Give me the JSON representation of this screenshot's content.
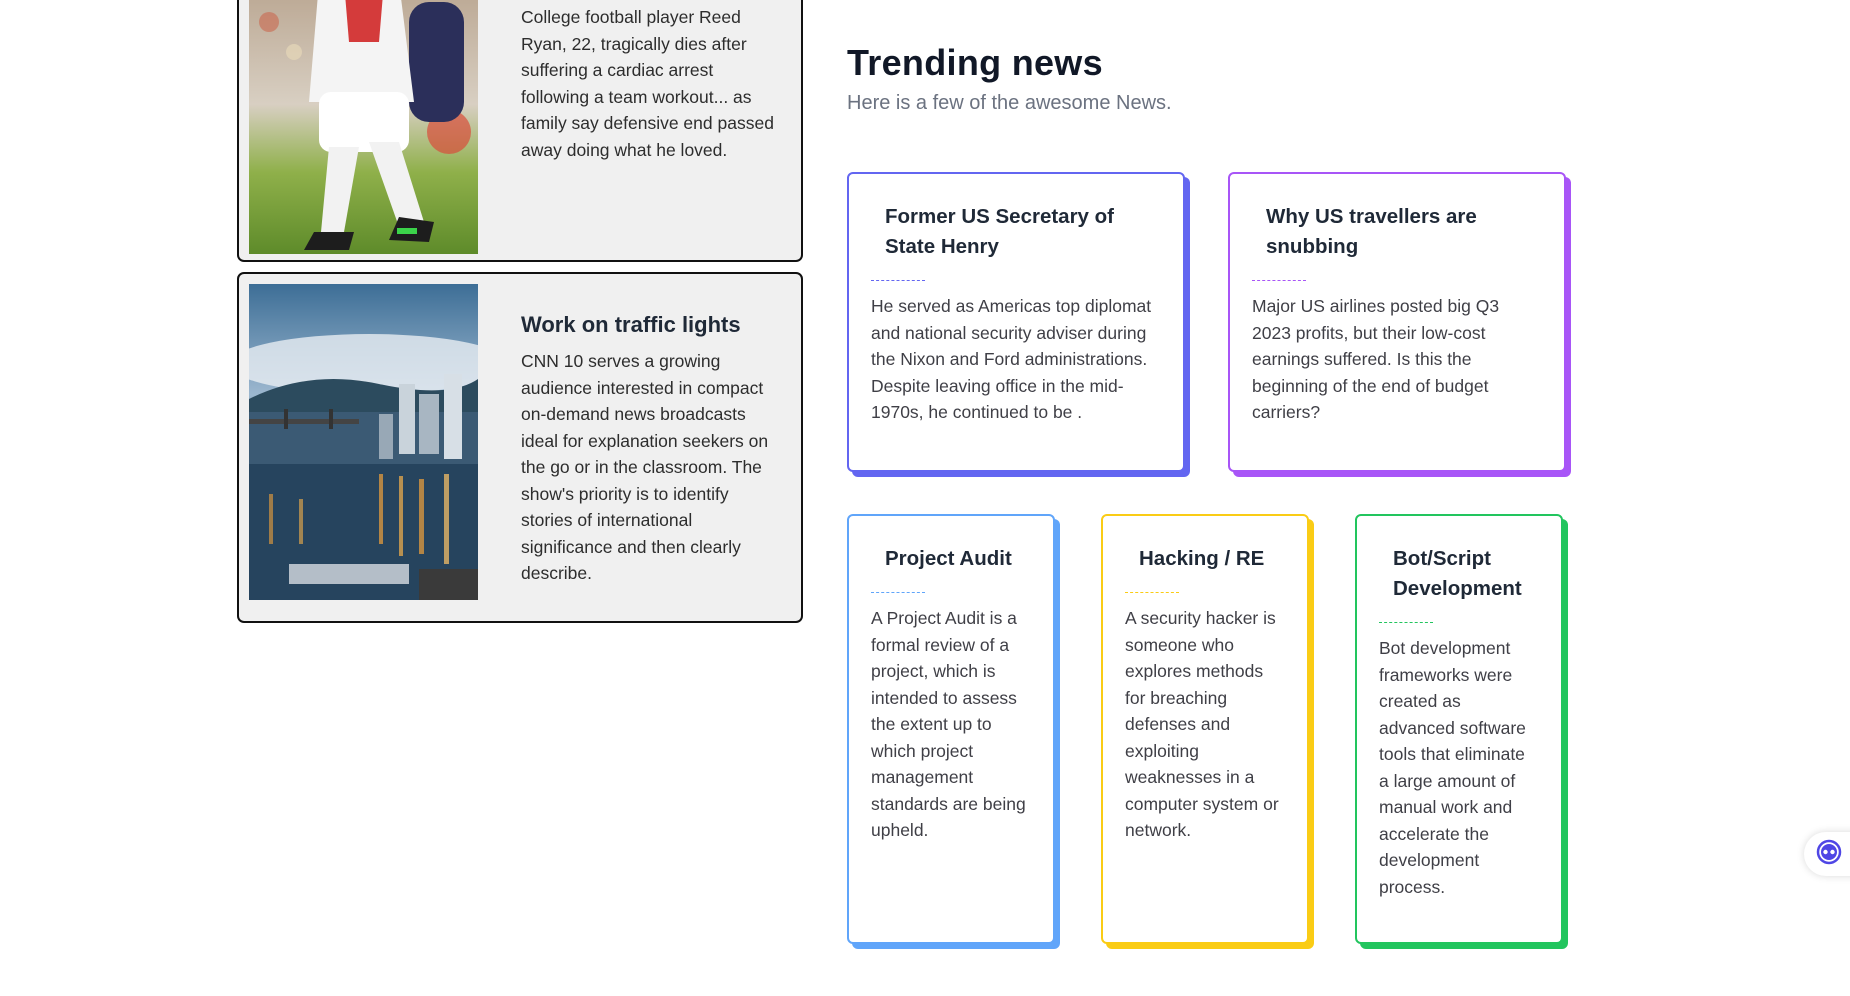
{
  "news": [
    {
      "title": "",
      "body": "College football player Reed Ryan, 22, tragically dies after suffering a cardiac arrest following a team workout... as family say defensive end passed away doing what he loved.",
      "image": "football-player-photo"
    },
    {
      "title": "Work on traffic lights",
      "body": "CNN 10 serves a growing audience interested in compact on-demand news broadcasts ideal for explanation seekers on the go or in the classroom. The show's priority is to identify stories of international significance and then clearly describe.",
      "image": "city-waterfront-photo"
    }
  ],
  "trending": {
    "title": "Trending news",
    "subtitle": "Here is a few of the awesome News.",
    "cards": [
      {
        "title": "Former US Secretary of State Henry",
        "body": "He served as Americas top diplomat and national security adviser during the Nixon and Ford administrations. Despite leaving office in the mid-1970s, he continued to be .",
        "color": "#6366f1"
      },
      {
        "title": "Why US travellers are snubbing",
        "body": "Major US airlines posted big Q3 2023 profits, but their low-cost earnings suffered. Is this the beginning of the end of budget carriers?",
        "color": "#a855f7"
      },
      {
        "title": "Project Audit",
        "body": "A Project Audit is a formal review of a project, which is intended to assess the extent up to which project management standards are being upheld.",
        "color": "#60a5fa"
      },
      {
        "title": "Hacking / RE",
        "body": "A security hacker is someone who explores methods for breaching defenses and exploiting weaknesses in a computer system or network.",
        "color": "#facc15"
      },
      {
        "title": "Bot/Script Development",
        "body": "Bot development frameworks were created as advanced software tools that eliminate a large amount of manual work and accelerate the development process.",
        "color": "#22c55e"
      }
    ]
  },
  "widget": {
    "icon": "assistant-icon",
    "color": "#4f46e5"
  }
}
